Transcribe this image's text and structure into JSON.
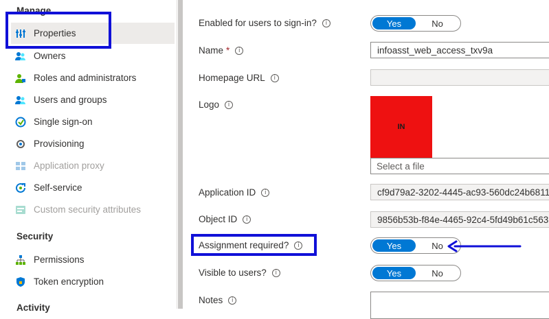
{
  "sidebar": {
    "sections": {
      "manage": "Manage",
      "security": "Security",
      "activity": "Activity"
    },
    "items": [
      {
        "label": "Properties",
        "icon": "properties-icon"
      },
      {
        "label": "Owners",
        "icon": "owners-icon"
      },
      {
        "label": "Roles and administrators",
        "icon": "roles-icon"
      },
      {
        "label": "Users and groups",
        "icon": "users-groups-icon"
      },
      {
        "label": "Single sign-on",
        "icon": "sso-icon"
      },
      {
        "label": "Provisioning",
        "icon": "provisioning-icon"
      },
      {
        "label": "Application proxy",
        "icon": "app-proxy-icon"
      },
      {
        "label": "Self-service",
        "icon": "self-service-icon"
      },
      {
        "label": "Custom security attributes",
        "icon": "custom-attributes-icon"
      },
      {
        "label": "Permissions",
        "icon": "permissions-icon"
      },
      {
        "label": "Token encryption",
        "icon": "token-encryption-icon"
      }
    ]
  },
  "form": {
    "enabled": {
      "label": "Enabled for users to sign-in?",
      "yes": "Yes",
      "no": "No",
      "value": "Yes"
    },
    "name": {
      "label": "Name",
      "required": "*",
      "value": "infoasst_web_access_txv9a"
    },
    "homepage": {
      "label": "Homepage URL",
      "value": ""
    },
    "logo": {
      "label": "Logo",
      "text": "IN",
      "file_placeholder": "Select a file",
      "color": "#ee1111"
    },
    "app_id": {
      "label": "Application ID",
      "value": "cf9d79a2-3202-4445-ac93-560dc24b6811"
    },
    "object_id": {
      "label": "Object ID",
      "value": "9856b53b-f84e-4465-92c4-5fd49b61c563"
    },
    "assignment": {
      "label": "Assignment required?",
      "yes": "Yes",
      "no": "No",
      "value": "Yes"
    },
    "visible": {
      "label": "Visible to users?",
      "yes": "Yes",
      "no": "No",
      "value": "Yes"
    },
    "notes": {
      "label": "Notes",
      "value": ""
    }
  },
  "info_glyph": "i",
  "colors": {
    "accent": "#0078d4",
    "highlight": "#1010d8",
    "logo_bg": "#ee1111"
  }
}
